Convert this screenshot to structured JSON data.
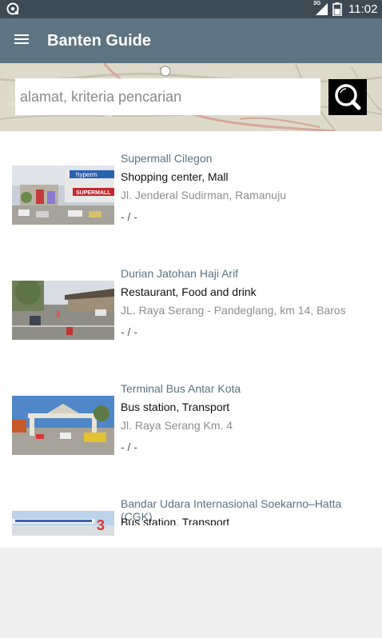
{
  "status_bar": {
    "network": "3G",
    "time": "11:02"
  },
  "app_bar": {
    "title": "Banten Guide"
  },
  "search": {
    "placeholder": "alamat, kriteria pencarian"
  },
  "places": [
    {
      "name": "Supermall Cilegon",
      "category": "Shopping center, Mall",
      "address": "Jl. Jenderal Sudirman, Ramanuju",
      "rating": "- / -",
      "image_signs": [
        "hyperm",
        "SUPERMALL"
      ]
    },
    {
      "name": "Durian Jatohan Haji Arif",
      "category": "Restaurant, Food and drink",
      "address": "JL. Raya Serang - Pandeglang, km 14, Baros",
      "rating": "- / -"
    },
    {
      "name": "Terminal Bus Antar Kota",
      "category": "Bus station, Transport",
      "address": "Jl. Raya Serang Km. 4",
      "rating": "- / -"
    },
    {
      "name": "Bandar Udara Internasional Soekarno–Hatta (CGK)",
      "category": "Bus station, Transport",
      "image_signs": [
        "3"
      ]
    }
  ],
  "colors": {
    "status_bar": "#3d4a54",
    "app_bar": "#5e7482",
    "place_name": "#5a7480",
    "background": "#eeeeee"
  }
}
